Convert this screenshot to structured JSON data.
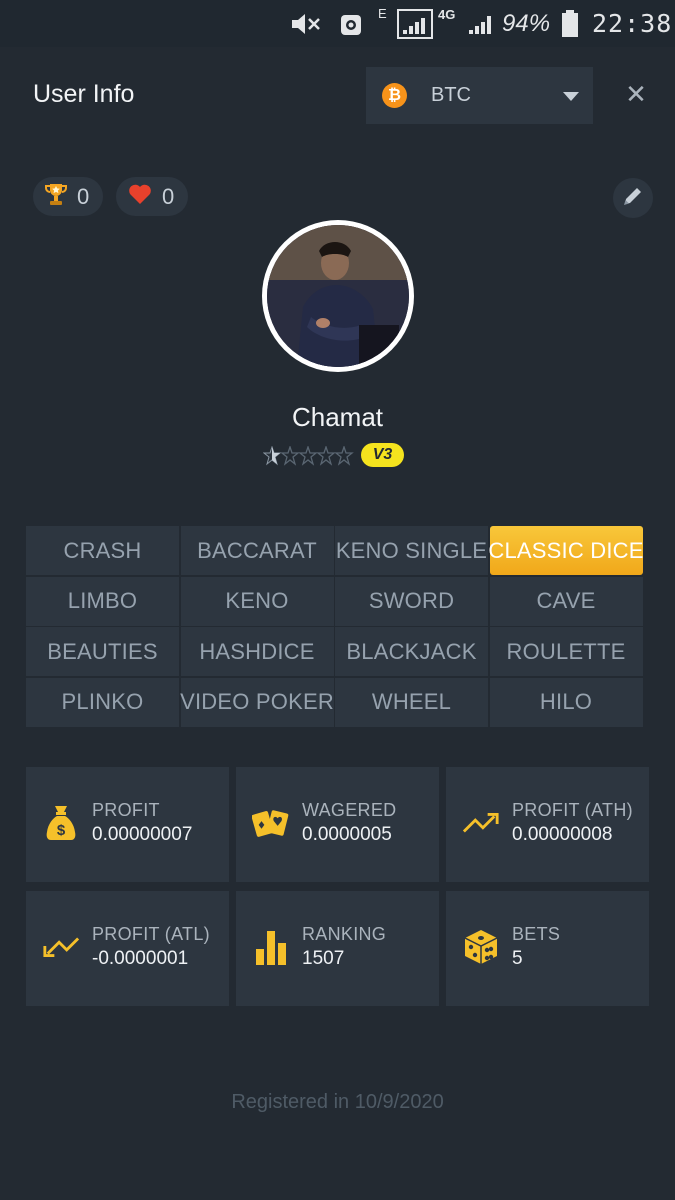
{
  "status_bar": {
    "battery_percent": "94%",
    "time": "22:38",
    "network": "4G",
    "edge": "E"
  },
  "header": {
    "title": "User Info",
    "currency": {
      "symbol": "₿",
      "label": "BTC"
    },
    "close_symbol": "✕"
  },
  "reactions": {
    "trophies": "0",
    "likes": "0"
  },
  "profile": {
    "username": "Chamat",
    "vip_badge": "V3",
    "stars_filled": 0,
    "stars_total": 5
  },
  "games": {
    "active": "CLASSIC DICE",
    "tabs": [
      "CRASH",
      "BACCARAT",
      "KENO SINGLE",
      "CLASSIC DICE",
      "LIMBO",
      "KENO",
      "SWORD",
      "CAVE",
      "BEAUTIES",
      "HASHDICE",
      "BLACKJACK",
      "ROULETTE",
      "PLINKO",
      "VIDEO POKER",
      "WHEEL",
      "HILO"
    ]
  },
  "stats": [
    {
      "label": "PROFIT",
      "value": "0.00000007",
      "icon": "money-bag-icon"
    },
    {
      "label": "WAGERED",
      "value": "0.0000005",
      "icon": "cards-icon"
    },
    {
      "label": "PROFIT (ATH)",
      "value": "0.00000008",
      "icon": "trend-up-icon"
    },
    {
      "label": "PROFIT (ATL)",
      "value": "-0.0000001",
      "icon": "trend-down-icon"
    },
    {
      "label": "RANKING",
      "value": "1507",
      "icon": "bar-chart-icon"
    },
    {
      "label": "BETS",
      "value": "5",
      "icon": "dice-icon"
    }
  ],
  "footer": {
    "registered": "Registered in 10/9/2020"
  },
  "colors": {
    "background": "#232a32",
    "panel": "#2d3640",
    "accent": "#f5b82a",
    "vip": "#f5e31e",
    "bitcoin": "#f7931a",
    "heart": "#e8412c"
  }
}
